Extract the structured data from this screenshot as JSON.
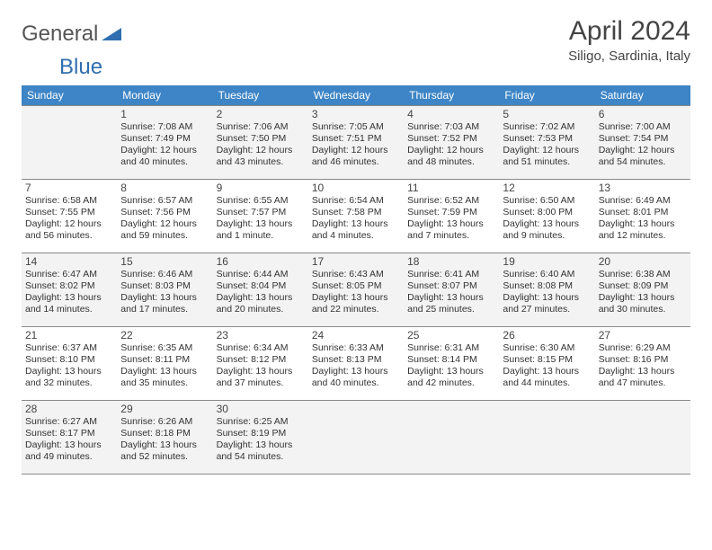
{
  "logo": {
    "text1": "General",
    "text2": "Blue"
  },
  "title": "April 2024",
  "location": "Siligo, Sardinia, Italy",
  "weekdays": [
    "Sunday",
    "Monday",
    "Tuesday",
    "Wednesday",
    "Thursday",
    "Friday",
    "Saturday"
  ],
  "weeks": [
    [
      {
        "day": "",
        "sunrise": "",
        "sunset": "",
        "daylight": ""
      },
      {
        "day": "1",
        "sunrise": "Sunrise: 7:08 AM",
        "sunset": "Sunset: 7:49 PM",
        "daylight": "Daylight: 12 hours and 40 minutes."
      },
      {
        "day": "2",
        "sunrise": "Sunrise: 7:06 AM",
        "sunset": "Sunset: 7:50 PM",
        "daylight": "Daylight: 12 hours and 43 minutes."
      },
      {
        "day": "3",
        "sunrise": "Sunrise: 7:05 AM",
        "sunset": "Sunset: 7:51 PM",
        "daylight": "Daylight: 12 hours and 46 minutes."
      },
      {
        "day": "4",
        "sunrise": "Sunrise: 7:03 AM",
        "sunset": "Sunset: 7:52 PM",
        "daylight": "Daylight: 12 hours and 48 minutes."
      },
      {
        "day": "5",
        "sunrise": "Sunrise: 7:02 AM",
        "sunset": "Sunset: 7:53 PM",
        "daylight": "Daylight: 12 hours and 51 minutes."
      },
      {
        "day": "6",
        "sunrise": "Sunrise: 7:00 AM",
        "sunset": "Sunset: 7:54 PM",
        "daylight": "Daylight: 12 hours and 54 minutes."
      }
    ],
    [
      {
        "day": "7",
        "sunrise": "Sunrise: 6:58 AM",
        "sunset": "Sunset: 7:55 PM",
        "daylight": "Daylight: 12 hours and 56 minutes."
      },
      {
        "day": "8",
        "sunrise": "Sunrise: 6:57 AM",
        "sunset": "Sunset: 7:56 PM",
        "daylight": "Daylight: 12 hours and 59 minutes."
      },
      {
        "day": "9",
        "sunrise": "Sunrise: 6:55 AM",
        "sunset": "Sunset: 7:57 PM",
        "daylight": "Daylight: 13 hours and 1 minute."
      },
      {
        "day": "10",
        "sunrise": "Sunrise: 6:54 AM",
        "sunset": "Sunset: 7:58 PM",
        "daylight": "Daylight: 13 hours and 4 minutes."
      },
      {
        "day": "11",
        "sunrise": "Sunrise: 6:52 AM",
        "sunset": "Sunset: 7:59 PM",
        "daylight": "Daylight: 13 hours and 7 minutes."
      },
      {
        "day": "12",
        "sunrise": "Sunrise: 6:50 AM",
        "sunset": "Sunset: 8:00 PM",
        "daylight": "Daylight: 13 hours and 9 minutes."
      },
      {
        "day": "13",
        "sunrise": "Sunrise: 6:49 AM",
        "sunset": "Sunset: 8:01 PM",
        "daylight": "Daylight: 13 hours and 12 minutes."
      }
    ],
    [
      {
        "day": "14",
        "sunrise": "Sunrise: 6:47 AM",
        "sunset": "Sunset: 8:02 PM",
        "daylight": "Daylight: 13 hours and 14 minutes."
      },
      {
        "day": "15",
        "sunrise": "Sunrise: 6:46 AM",
        "sunset": "Sunset: 8:03 PM",
        "daylight": "Daylight: 13 hours and 17 minutes."
      },
      {
        "day": "16",
        "sunrise": "Sunrise: 6:44 AM",
        "sunset": "Sunset: 8:04 PM",
        "daylight": "Daylight: 13 hours and 20 minutes."
      },
      {
        "day": "17",
        "sunrise": "Sunrise: 6:43 AM",
        "sunset": "Sunset: 8:05 PM",
        "daylight": "Daylight: 13 hours and 22 minutes."
      },
      {
        "day": "18",
        "sunrise": "Sunrise: 6:41 AM",
        "sunset": "Sunset: 8:07 PM",
        "daylight": "Daylight: 13 hours and 25 minutes."
      },
      {
        "day": "19",
        "sunrise": "Sunrise: 6:40 AM",
        "sunset": "Sunset: 8:08 PM",
        "daylight": "Daylight: 13 hours and 27 minutes."
      },
      {
        "day": "20",
        "sunrise": "Sunrise: 6:38 AM",
        "sunset": "Sunset: 8:09 PM",
        "daylight": "Daylight: 13 hours and 30 minutes."
      }
    ],
    [
      {
        "day": "21",
        "sunrise": "Sunrise: 6:37 AM",
        "sunset": "Sunset: 8:10 PM",
        "daylight": "Daylight: 13 hours and 32 minutes."
      },
      {
        "day": "22",
        "sunrise": "Sunrise: 6:35 AM",
        "sunset": "Sunset: 8:11 PM",
        "daylight": "Daylight: 13 hours and 35 minutes."
      },
      {
        "day": "23",
        "sunrise": "Sunrise: 6:34 AM",
        "sunset": "Sunset: 8:12 PM",
        "daylight": "Daylight: 13 hours and 37 minutes."
      },
      {
        "day": "24",
        "sunrise": "Sunrise: 6:33 AM",
        "sunset": "Sunset: 8:13 PM",
        "daylight": "Daylight: 13 hours and 40 minutes."
      },
      {
        "day": "25",
        "sunrise": "Sunrise: 6:31 AM",
        "sunset": "Sunset: 8:14 PM",
        "daylight": "Daylight: 13 hours and 42 minutes."
      },
      {
        "day": "26",
        "sunrise": "Sunrise: 6:30 AM",
        "sunset": "Sunset: 8:15 PM",
        "daylight": "Daylight: 13 hours and 44 minutes."
      },
      {
        "day": "27",
        "sunrise": "Sunrise: 6:29 AM",
        "sunset": "Sunset: 8:16 PM",
        "daylight": "Daylight: 13 hours and 47 minutes."
      }
    ],
    [
      {
        "day": "28",
        "sunrise": "Sunrise: 6:27 AM",
        "sunset": "Sunset: 8:17 PM",
        "daylight": "Daylight: 13 hours and 49 minutes."
      },
      {
        "day": "29",
        "sunrise": "Sunrise: 6:26 AM",
        "sunset": "Sunset: 8:18 PM",
        "daylight": "Daylight: 13 hours and 52 minutes."
      },
      {
        "day": "30",
        "sunrise": "Sunrise: 6:25 AM",
        "sunset": "Sunset: 8:19 PM",
        "daylight": "Daylight: 13 hours and 54 minutes."
      },
      {
        "day": "",
        "sunrise": "",
        "sunset": "",
        "daylight": ""
      },
      {
        "day": "",
        "sunrise": "",
        "sunset": "",
        "daylight": ""
      },
      {
        "day": "",
        "sunrise": "",
        "sunset": "",
        "daylight": ""
      },
      {
        "day": "",
        "sunrise": "",
        "sunset": "",
        "daylight": ""
      }
    ]
  ]
}
